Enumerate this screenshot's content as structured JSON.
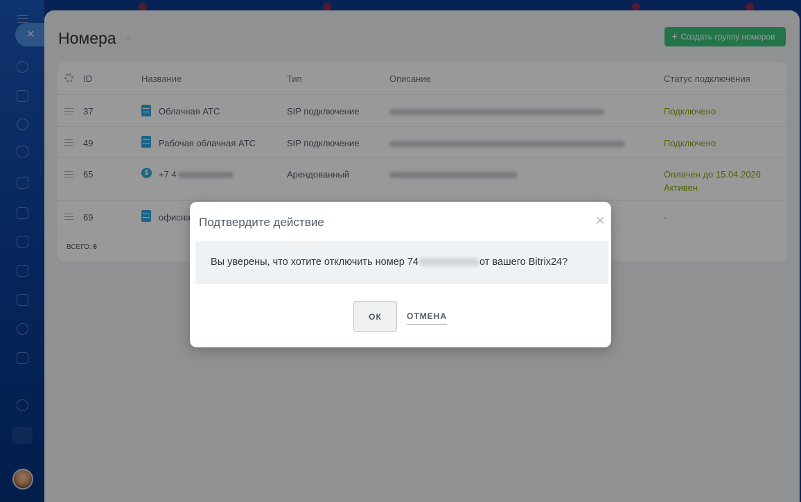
{
  "page": {
    "title": "Номера",
    "create_button": "Создать группу номеров"
  },
  "columns": {
    "id": "ID",
    "name": "Название",
    "type": "Тип",
    "description": "Описание",
    "status": "Статус подключения"
  },
  "rows": [
    {
      "id": "37",
      "name": "Облачная АТС",
      "type": "SIP подключение",
      "status": "Подключено",
      "status_line2": ""
    },
    {
      "id": "49",
      "name": "Рабочая облачная АТС",
      "type": "SIP подключение",
      "status": "Подключено",
      "status_line2": ""
    },
    {
      "id": "65",
      "name": "+7 4",
      "type": "Арендованный",
      "status": "Оплачен до 15.04.2026",
      "status_line2": "Активен"
    },
    {
      "id": "69",
      "name": "офисна",
      "type": "",
      "status": "-",
      "status_line2": ""
    }
  ],
  "footer": {
    "total_label": "ВСЕГО:",
    "total_value": "6"
  },
  "dialog": {
    "title": "Подтвердите действие",
    "message_before": "Вы уверены, что хотите отключить номер 74",
    "message_after": "от вашего Bitrix24?",
    "ok_label": "ОК",
    "cancel_label": "ОТМЕНА"
  },
  "colors": {
    "accent_green": "#3bc47a",
    "status_green": "#7fa800",
    "icon_blue": "#2fa9e0"
  }
}
